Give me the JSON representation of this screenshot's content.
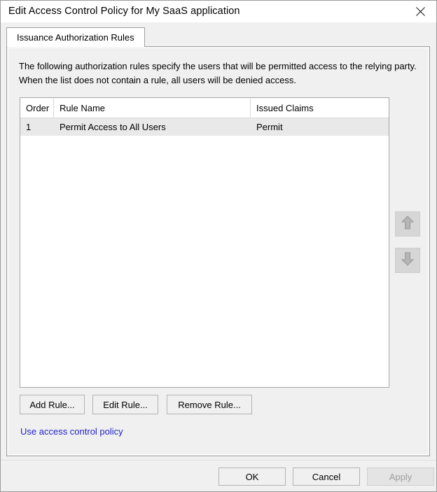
{
  "window": {
    "title": "Edit Access Control Policy for My SaaS application",
    "close_icon": "close-icon"
  },
  "tabs": [
    {
      "label": "Issuance Authorization Rules",
      "selected": true
    }
  ],
  "description": "The following authorization rules specify the users that will be permitted access to the relying party. When the list does not contain a rule, all users will be denied access.",
  "rules_table": {
    "columns": [
      "Order",
      "Rule Name",
      "Issued Claims"
    ],
    "rows": [
      {
        "order": "1",
        "rule_name": "Permit Access to All Users",
        "issued_claims": "Permit"
      }
    ]
  },
  "order_buttons": {
    "move_up": {
      "icon": "arrow-up-icon",
      "enabled": false
    },
    "move_down": {
      "icon": "arrow-down-icon",
      "enabled": false
    }
  },
  "rule_actions": {
    "add": "Add Rule...",
    "edit": "Edit Rule...",
    "remove": "Remove Rule..."
  },
  "policy_link": "Use access control policy",
  "footer": {
    "ok": "OK",
    "cancel": "Cancel",
    "apply": "Apply",
    "apply_enabled": false
  },
  "colors": {
    "dialog_background": "#f0f0f0",
    "titlebar_background": "#ffffff",
    "link": "#2222cc",
    "selected_row": "#e9e9e9",
    "disabled_text": "#9d9d9d"
  }
}
